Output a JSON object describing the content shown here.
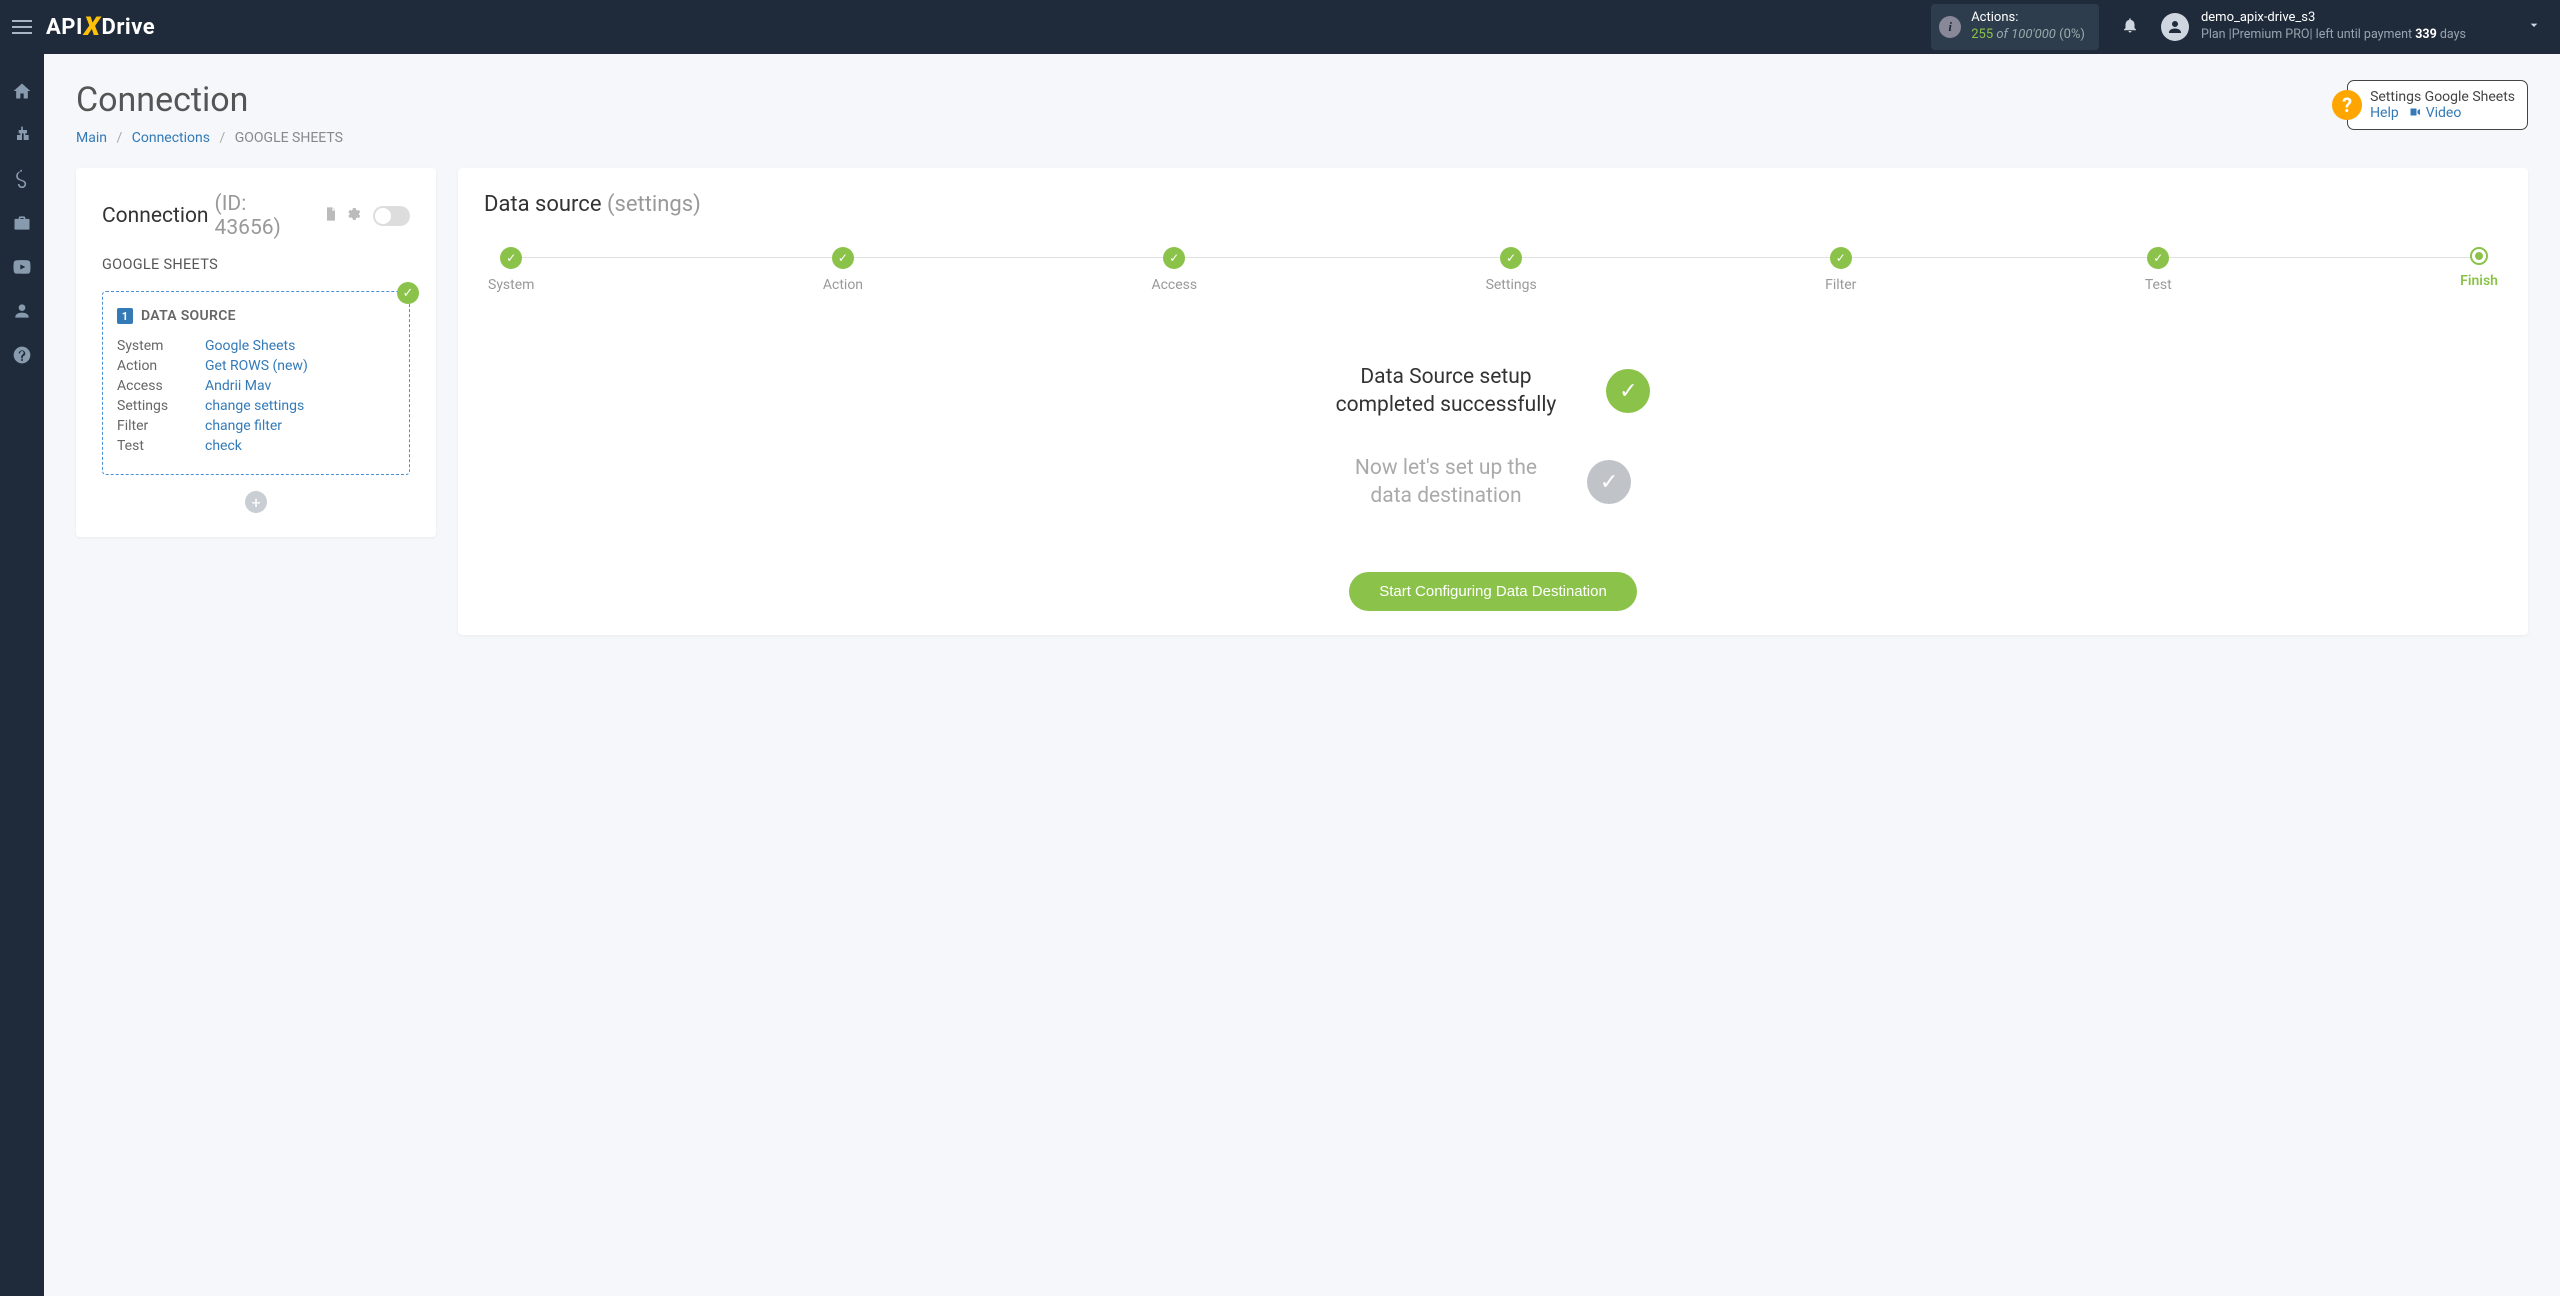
{
  "topbar": {
    "logo_pre": "API",
    "logo_x": "X",
    "logo_post": "Drive",
    "actions_label": "Actions:",
    "actions_used": "255",
    "actions_of": "of",
    "actions_total": "100'000",
    "actions_pct": "(0%)",
    "username": "demo_apix-drive_s3",
    "plan_prefix": "Plan |",
    "plan_name": "Premium PRO",
    "plan_suffix": "| left until payment ",
    "days_num": "339",
    "days_word": " days"
  },
  "page": {
    "title": "Connection",
    "breadcrumb": {
      "main": "Main",
      "connections": "Connections",
      "current": "GOOGLE SHEETS"
    }
  },
  "help": {
    "title": "Settings Google Sheets",
    "help_link": "Help",
    "video_link": "Video"
  },
  "left": {
    "conn_label": "Connection ",
    "conn_id": "(ID: 43656)",
    "conn_sub": "GOOGLE SHEETS",
    "ds_badge": "1",
    "ds_title": "DATA SOURCE",
    "rows": [
      {
        "k": "System",
        "v": "Google Sheets"
      },
      {
        "k": "Action",
        "v": "Get ROWS (new)"
      },
      {
        "k": "Access",
        "v": "Andrii Mav"
      },
      {
        "k": "Settings",
        "v": "change settings"
      },
      {
        "k": "Filter",
        "v": "change filter"
      },
      {
        "k": "Test",
        "v": "check"
      }
    ]
  },
  "right": {
    "title": "Data source ",
    "title_suffix": "(settings)",
    "steps": [
      "System",
      "Action",
      "Access",
      "Settings",
      "Filter",
      "Test",
      "Finish"
    ],
    "msg1": "Data Source setup completed successfully",
    "msg2": "Now let's set up the data destination",
    "cta": "Start Configuring Data Destination"
  }
}
